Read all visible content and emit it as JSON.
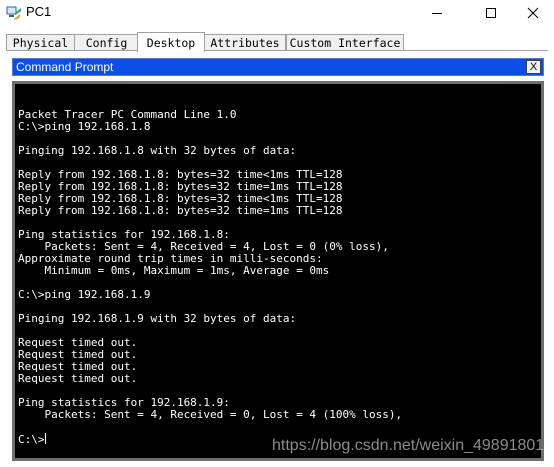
{
  "window": {
    "title": "PC1",
    "app_icon": "packet-tracer-pc-icon",
    "controls": {
      "minimize_icon": "minimize-icon",
      "maximize_icon": "maximize-icon",
      "close_icon": "close-icon"
    }
  },
  "tabs": [
    {
      "label": "Physical",
      "active": false
    },
    {
      "label": "Config",
      "active": false
    },
    {
      "label": "Desktop",
      "active": true
    },
    {
      "label": "Attributes",
      "active": false
    },
    {
      "label": "Custom Interface",
      "active": false
    }
  ],
  "command_prompt": {
    "title": "Command Prompt",
    "close_label": "X",
    "lines": [
      "",
      "Packet Tracer PC Command Line 1.0",
      "C:\\>ping 192.168.1.8",
      "",
      "Pinging 192.168.1.8 with 32 bytes of data:",
      "",
      "Reply from 192.168.1.8: bytes=32 time<1ms TTL=128",
      "Reply from 192.168.1.8: bytes=32 time=1ms TTL=128",
      "Reply from 192.168.1.8: bytes=32 time<1ms TTL=128",
      "Reply from 192.168.1.8: bytes=32 time=1ms TTL=128",
      "",
      "Ping statistics for 192.168.1.8:",
      "    Packets: Sent = 4, Received = 4, Lost = 0 (0% loss),",
      "Approximate round trip times in milli-seconds:",
      "    Minimum = 0ms, Maximum = 1ms, Average = 0ms",
      "",
      "C:\\>ping 192.168.1.9",
      "",
      "Pinging 192.168.1.9 with 32 bytes of data:",
      "",
      "Request timed out.",
      "Request timed out.",
      "Request timed out.",
      "Request timed out.",
      "",
      "Ping statistics for 192.168.1.9:",
      "    Packets: Sent = 4, Received = 0, Lost = 4 (100% loss),",
      "",
      "C:\\>"
    ]
  },
  "watermark": "https://blog.csdn.net/weixin_49891801"
}
